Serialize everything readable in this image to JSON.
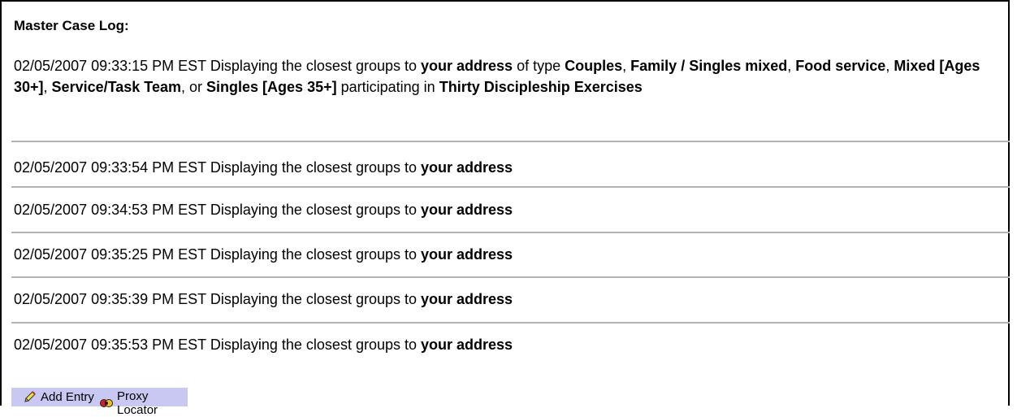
{
  "log": {
    "title": "Master Case Log:",
    "first_entry": {
      "timestamp": "02/05/2007 09:33:15 PM EST",
      "text_prefix": "Displaying the closest groups to",
      "address": "your address",
      "of_type": "of type",
      "types": [
        "Couples",
        "Family / Singles mixed",
        "Food service",
        "Mixed [Ages 30+]",
        "Service/Task Team",
        "Singles [Ages 35+]"
      ],
      "or_word": "or",
      "participating": "participating in",
      "program": "Thirty Discipleship Exercises"
    },
    "entries": [
      {
        "timestamp": "02/05/2007 09:33:54 PM EST",
        "text": "Displaying the closest groups to",
        "address": "your address"
      },
      {
        "timestamp": "02/05/2007 09:34:53 PM EST",
        "text": "Displaying the closest groups to",
        "address": "your address"
      },
      {
        "timestamp": "02/05/2007 09:35:25 PM EST",
        "text": "Displaying the closest groups to",
        "address": "your address"
      },
      {
        "timestamp": "02/05/2007 09:35:39 PM EST",
        "text": "Displaying the closest groups to",
        "address": "your address"
      },
      {
        "timestamp": "02/05/2007 09:35:53 PM EST",
        "text": "Displaying the closest groups to",
        "address": "your address"
      }
    ]
  },
  "toolbar": {
    "add_entry_label": "Add Entry",
    "add_entry_icon": "pencil-icon",
    "proxy_locator_label": "Proxy Locator",
    "proxy_locator_icon": "proxy-locator-icon"
  },
  "colors": {
    "toolbar_bg": "#c8c8f2",
    "separator": "#b3b3b3"
  }
}
